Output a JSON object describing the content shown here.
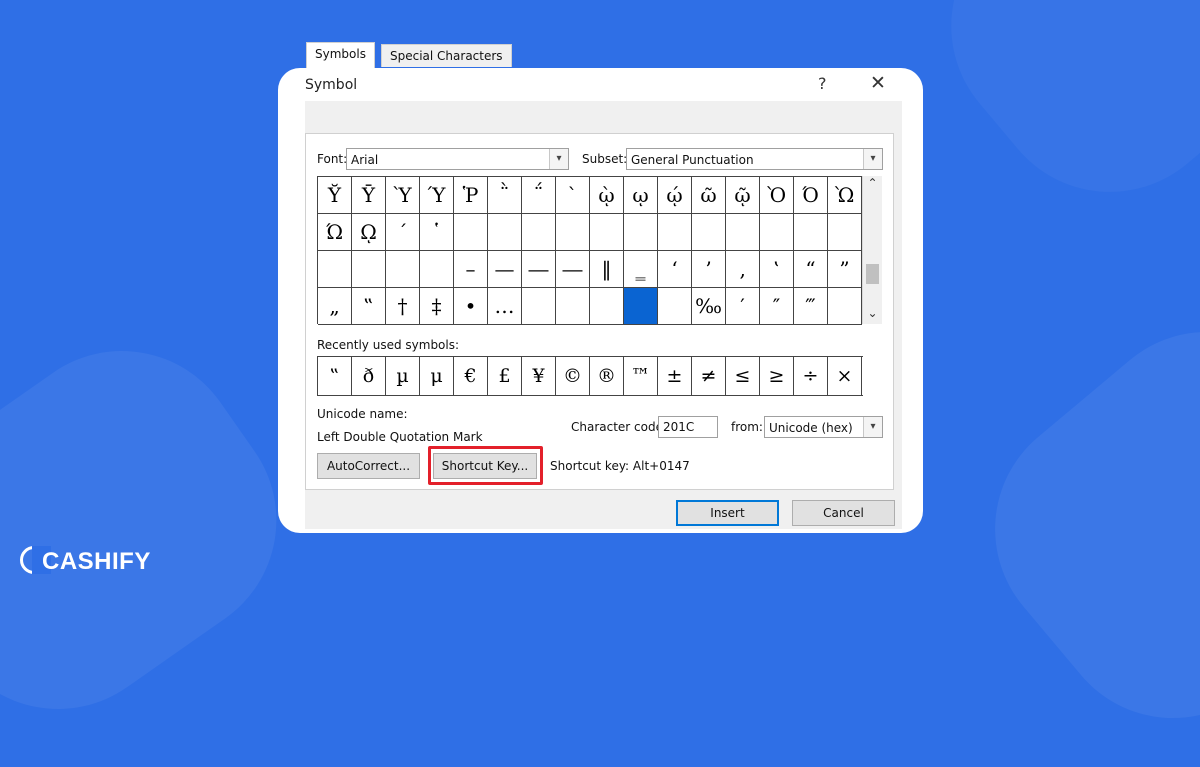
{
  "dialog": {
    "title": "Symbol",
    "help": "?",
    "close": "✕"
  },
  "tabs": [
    {
      "label": "Symbols"
    },
    {
      "label": "Special Characters"
    }
  ],
  "font": {
    "label": "Font:",
    "value": "Arial"
  },
  "subset": {
    "label": "Subset:",
    "value": "General Punctuation"
  },
  "grid": {
    "selected_index": 57,
    "symbols": [
      "Ῠ",
      "Ῡ",
      "Ὺ",
      "Ύ",
      "Ῥ",
      "῭",
      "΅",
      "`",
      "ῲ",
      "ῳ",
      "ῴ",
      "ῶ",
      "ῷ",
      "Ὸ",
      "Ό",
      "Ὼ",
      "Ώ",
      "ῼ",
      "´",
      "῾",
      "",
      "",
      "",
      "",
      "",
      "",
      "",
      "",
      "",
      "",
      "",
      "",
      "",
      "",
      "",
      "",
      "–",
      "—",
      "―",
      "―",
      "‖",
      "‗",
      "‘",
      "’",
      "‚",
      "‛",
      "“",
      "”",
      "„",
      "‟",
      "†",
      "‡",
      "•",
      "…",
      "",
      "",
      "",
      "",
      "",
      "‰",
      "′",
      "″",
      "‴",
      ""
    ]
  },
  "recent": {
    "label": "Recently used symbols:",
    "symbols": [
      "‟",
      "ð",
      "µ",
      "μ",
      "€",
      "£",
      "¥",
      "©",
      "®",
      "™",
      "±",
      "≠",
      "≤",
      "≥",
      "÷",
      "×"
    ]
  },
  "unicode_name": {
    "label": "Unicode name:",
    "value": "Left Double Quotation Mark"
  },
  "char_code": {
    "label": "Character code:",
    "value": "201C"
  },
  "from": {
    "label": "from:",
    "value": "Unicode (hex)"
  },
  "buttons": {
    "autocorrect": "AutoCorrect...",
    "shortcut_key": "Shortcut Key...",
    "insert": "Insert",
    "cancel": "Cancel"
  },
  "shortcut_key_text": "Shortcut key: Alt+0147",
  "brand": {
    "name": "CASHIFY"
  },
  "colors": {
    "background": "#2f6fe6",
    "selection": "#0a64d2",
    "highlight": "#e3202a"
  }
}
